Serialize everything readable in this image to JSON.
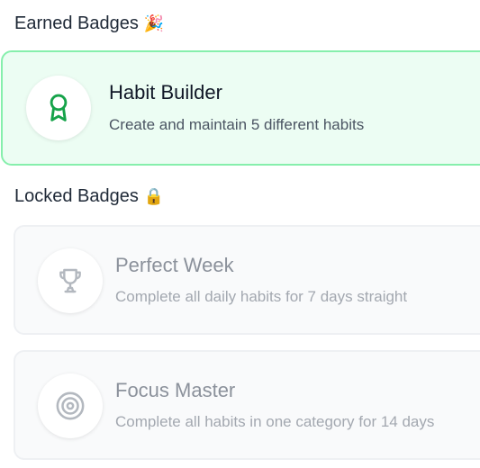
{
  "earned": {
    "heading": "Earned Badges",
    "heading_emoji": "🎉",
    "badges": [
      {
        "title": "Habit Builder",
        "description": "Create and maintain 5 different habits",
        "icon": "award-ribbon-icon",
        "accent": "#16a34a"
      }
    ]
  },
  "locked": {
    "heading": "Locked Badges",
    "heading_emoji": "🔒",
    "badges": [
      {
        "title": "Perfect Week",
        "description": "Complete all daily habits for 7 days straight",
        "icon": "trophy-icon"
      },
      {
        "title": "Focus Master",
        "description": "Complete all habits in one category for 14 days",
        "icon": "target-icon"
      }
    ]
  },
  "colors": {
    "earned_bg": "#ecfdf3",
    "earned_border": "#86efac",
    "locked_bg": "#f9fafb",
    "locked_text": "#8b919b"
  }
}
